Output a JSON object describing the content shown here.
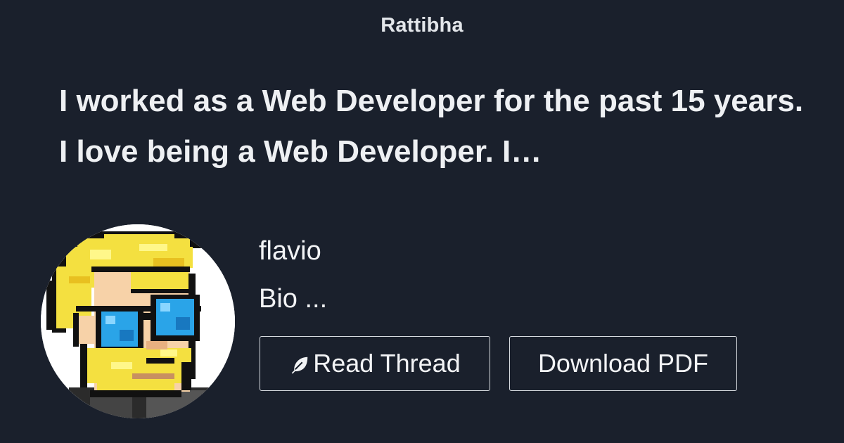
{
  "header": {
    "brand": "Rattibha"
  },
  "thread": {
    "title": "I worked as a Web Developer for the past 15 years. I love being a Web Developer. I…"
  },
  "author": {
    "username": "flavio",
    "bio": "Bio ..."
  },
  "actions": {
    "read_thread_label": "Read Thread",
    "download_pdf_label": "Download PDF"
  },
  "icons": {
    "read_thread_icon": "feather-icon"
  },
  "colors": {
    "background": "#1a202c",
    "text": "#eef0f3",
    "button_border": "#d7dbe0"
  }
}
